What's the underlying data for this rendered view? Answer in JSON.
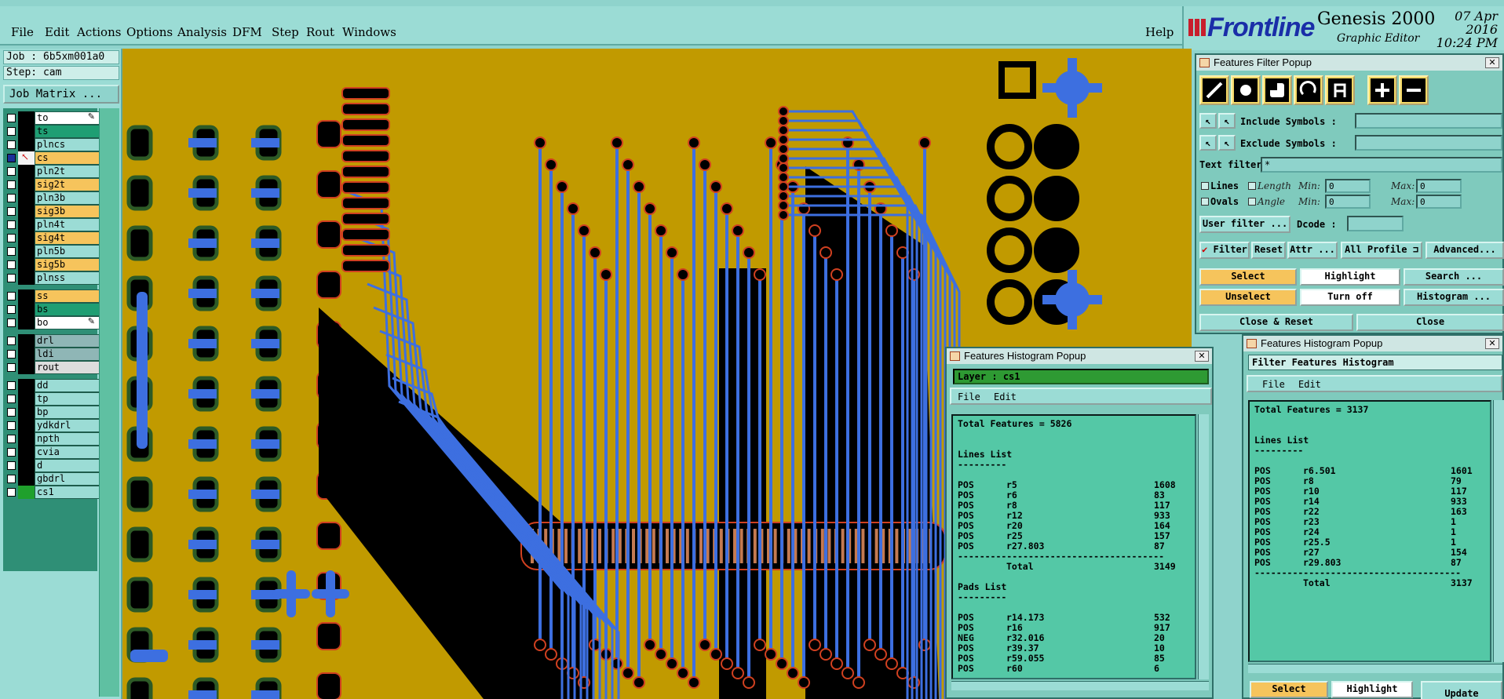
{
  "menu": {
    "items": [
      "File",
      "Edit",
      "Actions",
      "Options",
      "Analysis",
      "DFM",
      "Step",
      "Rout",
      "Windows"
    ],
    "help": "Help"
  },
  "brand": {
    "logo": "Frontline",
    "product": "Genesis 2000",
    "subtitle": "Graphic Editor",
    "date": "07 Apr 2016",
    "time": "10:24 PM"
  },
  "left_panel": {
    "job": "Job : 6b5xm001a0",
    "step": "Step: cam",
    "job_matrix_button": "Job Matrix ...",
    "layers": [
      {
        "name": "to",
        "color": "#ffffff",
        "checked": false,
        "mark": "pen"
      },
      {
        "name": "ts",
        "color": "#1f9e73",
        "checked": false,
        "mark": ""
      },
      {
        "name": "plncs",
        "color": "#9bdcd5",
        "checked": false,
        "mark": ""
      },
      {
        "name": "cs",
        "color": "#f6c45c",
        "checked": true,
        "mark": "arrow"
      },
      {
        "name": "pln2t",
        "color": "#9bdcd5",
        "checked": false,
        "mark": ""
      },
      {
        "name": "sig2t",
        "color": "#f6c45c",
        "checked": false,
        "mark": ""
      },
      {
        "name": "pln3b",
        "color": "#9bdcd5",
        "checked": false,
        "mark": ""
      },
      {
        "name": "sig3b",
        "color": "#f6c45c",
        "checked": false,
        "mark": ""
      },
      {
        "name": "pln4t",
        "color": "#9bdcd5",
        "checked": false,
        "mark": ""
      },
      {
        "name": "sig4t",
        "color": "#f6c45c",
        "checked": false,
        "mark": ""
      },
      {
        "name": "pln5b",
        "color": "#9bdcd5",
        "checked": false,
        "mark": ""
      },
      {
        "name": "sig5b",
        "color": "#f6c45c",
        "checked": false,
        "mark": ""
      },
      {
        "name": "plnss",
        "color": "#9bdcd5",
        "checked": false,
        "mark": ""
      },
      {
        "name": "ss",
        "color": "#f6c45c",
        "checked": false,
        "mark": ""
      },
      {
        "name": "bs",
        "color": "#1f9e73",
        "checked": false,
        "mark": ""
      },
      {
        "name": "bo",
        "color": "#ffffff",
        "checked": false,
        "mark": "pen"
      },
      {
        "name": "drl",
        "color": "#8fb6b6",
        "checked": false,
        "mark": ""
      },
      {
        "name": "ldi",
        "color": "#8fb6b6",
        "checked": false,
        "mark": ""
      },
      {
        "name": "rout",
        "color": "#dddddd",
        "checked": false,
        "mark": ""
      },
      {
        "name": "dd",
        "color": "#9bdcd5",
        "checked": false,
        "mark": ""
      },
      {
        "name": "tp",
        "color": "#9bdcd5",
        "checked": false,
        "mark": ""
      },
      {
        "name": "bp",
        "color": "#9bdcd5",
        "checked": false,
        "mark": ""
      },
      {
        "name": "ydkdrl",
        "color": "#9bdcd5",
        "checked": false,
        "mark": ""
      },
      {
        "name": "npth",
        "color": "#9bdcd5",
        "checked": false,
        "mark": ""
      },
      {
        "name": "cvia",
        "color": "#9bdcd5",
        "checked": false,
        "mark": ""
      },
      {
        "name": "d",
        "color": "#9bdcd5",
        "checked": false,
        "mark": ""
      },
      {
        "name": "gbdrl",
        "color": "#9bdcd5",
        "checked": false,
        "mark": ""
      },
      {
        "name": "cs1",
        "color": "#9bdcd5",
        "checked": false,
        "mark": "green"
      }
    ]
  },
  "filter_popup": {
    "title": "Features Filter Popup",
    "include_label": "Include Symbols :",
    "exclude_label": "Exclude Symbols :",
    "text_filter_label": "Text filter",
    "text_filter_value": "*",
    "lines_label": "Lines",
    "ovals_label": "Ovals",
    "length_label": "Length",
    "angle_label": "Angle",
    "min_label": "Min:",
    "max_label": "Max:",
    "length_min": "0",
    "length_max": "0",
    "angle_min": "0",
    "angle_max": "0",
    "user_filter_button": "User filter ...",
    "dcode_label": "Dcode :",
    "filter_toggle": "Filter",
    "reset_button": "Reset",
    "attr_button": "Attr ...",
    "profile_option": "All Profile",
    "advanced_button": "Advanced...",
    "select_button": "Select",
    "highlight_button": "Highlight",
    "search_button": "Search ...",
    "unselect_button": "Unselect",
    "turnoff_button": "Turn off",
    "histogram_button": "Histogram ...",
    "close_reset_button": "Close & Reset",
    "close_button": "Close"
  },
  "hist1": {
    "title": "Features Histogram Popup",
    "layer_label": "Layer :",
    "layer_value": "cs1",
    "menu_file": "File",
    "menu_edit": "Edit",
    "total": "Total Features = 5826",
    "lines_header": "Lines List",
    "lines": [
      {
        "pol": "POS",
        "sym": "r5",
        "count": "1608"
      },
      {
        "pol": "POS",
        "sym": "r6",
        "count": "83"
      },
      {
        "pol": "POS",
        "sym": "r8",
        "count": "117"
      },
      {
        "pol": "POS",
        "sym": "r12",
        "count": "933"
      },
      {
        "pol": "POS",
        "sym": "r20",
        "count": "164"
      },
      {
        "pol": "POS",
        "sym": "r25",
        "count": "157"
      },
      {
        "pol": "POS",
        "sym": "r27.803",
        "count": "87"
      }
    ],
    "lines_total_label": "Total",
    "lines_total": "3149",
    "pads_header": "Pads List",
    "pads": [
      {
        "pol": "POS",
        "sym": "r14.173",
        "count": "532"
      },
      {
        "pol": "POS",
        "sym": "r16",
        "count": "917"
      },
      {
        "pol": "NEG",
        "sym": "r32.016",
        "count": "20"
      },
      {
        "pol": "POS",
        "sym": "r39.37",
        "count": "10"
      },
      {
        "pol": "POS",
        "sym": "r59.055",
        "count": "85"
      },
      {
        "pol": "POS",
        "sym": "r60",
        "count": "6"
      }
    ]
  },
  "hist2": {
    "title": "Features Histogram Popup",
    "header": "Filter Features Histogram",
    "menu_file": "File",
    "menu_edit": "Edit",
    "total": "Total Features = 3137",
    "lines_header": "Lines List",
    "lines": [
      {
        "pol": "POS",
        "sym": "r6.501",
        "count": "1601"
      },
      {
        "pol": "POS",
        "sym": "r8",
        "count": "79"
      },
      {
        "pol": "POS",
        "sym": "r10",
        "count": "117"
      },
      {
        "pol": "POS",
        "sym": "r14",
        "count": "933"
      },
      {
        "pol": "POS",
        "sym": "r22",
        "count": "163"
      },
      {
        "pol": "POS",
        "sym": "r23",
        "count": "1"
      },
      {
        "pol": "POS",
        "sym": "r24",
        "count": "1"
      },
      {
        "pol": "POS",
        "sym": "r25.5",
        "count": "1"
      },
      {
        "pol": "POS",
        "sym": "r27",
        "count": "154"
      },
      {
        "pol": "POS",
        "sym": "r29.803",
        "count": "87"
      }
    ],
    "lines_total_label": "Total",
    "lines_total": "3137",
    "select_button": "Select",
    "highlight_button": "Highlight",
    "update_button": "Update"
  },
  "colors": {
    "board": "#c19a00",
    "trace": "#3d6fe0",
    "copper_dark": "#000000",
    "pad_outline": "#d04020",
    "panel": "#9bdcd5"
  }
}
